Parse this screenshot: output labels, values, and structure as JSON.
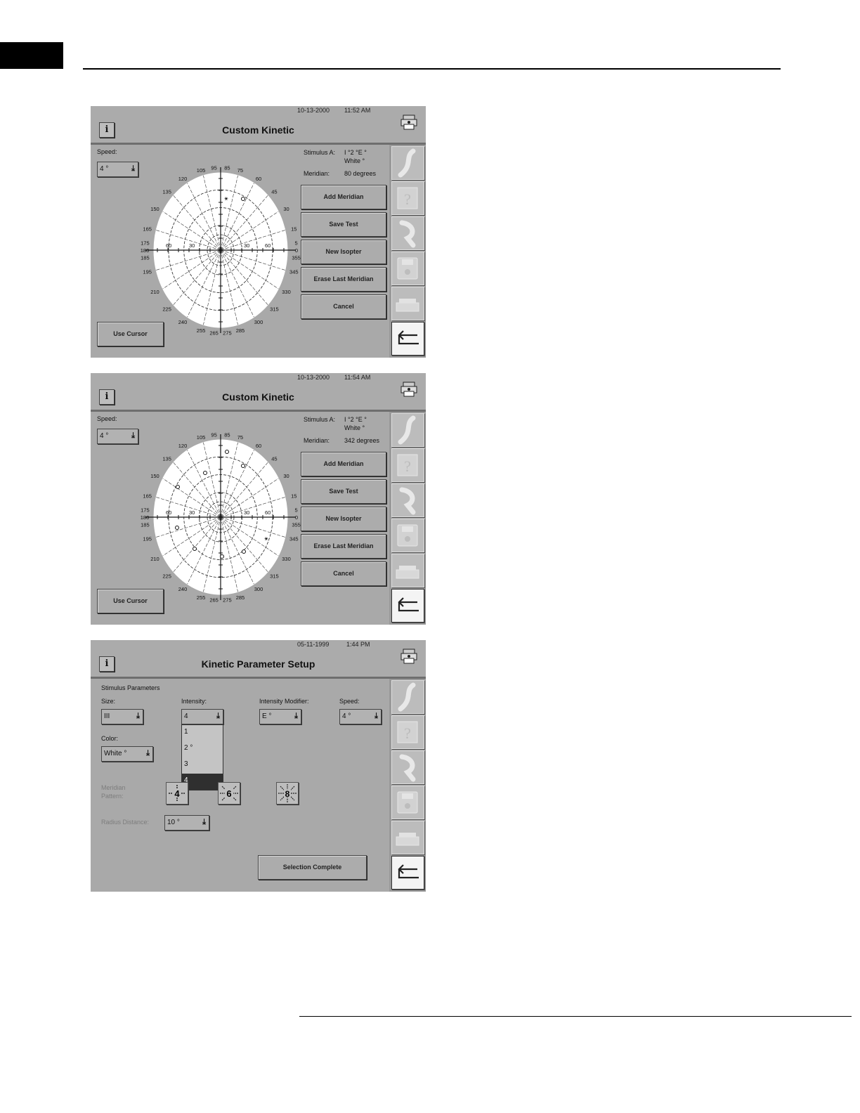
{
  "screen1": {
    "date": "10-13-2000",
    "time": "11:52 AM",
    "title": "Custom Kinetic",
    "speed_label": "Speed:",
    "speed_value": "4 °",
    "stimulus_label": "Stimulus A:",
    "stimulus_value": "I °2 °E °",
    "color_value": "White °",
    "meridian_label": "Meridian:",
    "meridian_value": "80 degrees",
    "buttons": [
      "Add Meridian",
      "Save Test",
      "New Isopter",
      "Erase Last Meridian",
      "Cancel"
    ],
    "use_cursor": "Use Cursor"
  },
  "screen2": {
    "date": "10-13-2000",
    "time": "11:54 AM",
    "title": "Custom Kinetic",
    "speed_label": "Speed:",
    "speed_value": "4 °",
    "stimulus_label": "Stimulus A:",
    "stimulus_value": "I °2 °E °",
    "color_value": "White °",
    "meridian_label": "Meridian:",
    "meridian_value": "342 degrees",
    "buttons": [
      "Add Meridian",
      "Save Test",
      "New Isopter",
      "Erase Last Meridian",
      "Cancel"
    ],
    "use_cursor": "Use Cursor"
  },
  "screen3": {
    "date": "05-11-1999",
    "time": "1:44 PM",
    "title": "Kinetic Parameter Setup",
    "section": "Stimulus Parameters",
    "size_label": "Size:",
    "size_value": "III",
    "intensity_label": "Intensity:",
    "intensity_value": "4",
    "intensity_options": [
      "1",
      "2 °",
      "3",
      "4"
    ],
    "intensity_selected": "4",
    "modifier_label": "Intensity Modifier:",
    "modifier_value": "E °",
    "speed_label": "Speed:",
    "speed_value": "4 °",
    "color_label": "Color:",
    "color_value": "White °",
    "meridian_pattern_label": "Meridian Pattern:",
    "pattern_4": "4",
    "pattern_6": "6",
    "pattern_8": "8",
    "radius_label": "Radius Distance:",
    "radius_value": "10 °",
    "selection_complete": "Selection Complete"
  },
  "polar_labels": {
    "angles": [
      "95",
      "85",
      "75",
      "105",
      "120",
      "60",
      "135",
      "45",
      "150",
      "30",
      "165",
      "15",
      "175",
      "5",
      "180",
      "0",
      "185",
      "355",
      "195",
      "345",
      "210",
      "330",
      "225",
      "315",
      "240",
      "300",
      "255",
      "285",
      "265",
      "275"
    ],
    "radii": [
      "60",
      "30",
      "30",
      "60"
    ]
  },
  "icons": {
    "info": "i",
    "printer": "printer-icon",
    "side": [
      "stimulus-icon",
      "help-icon",
      "patient-icon",
      "save-disk-icon",
      "printer-tray-icon",
      "return-arrow-icon"
    ]
  }
}
